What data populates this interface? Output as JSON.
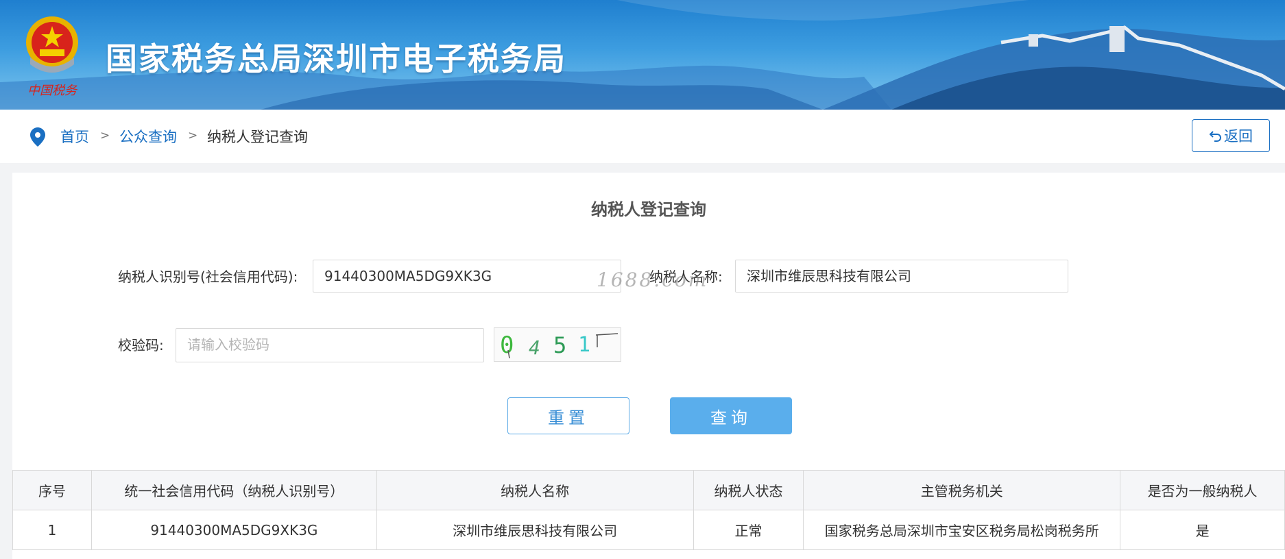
{
  "header": {
    "site_title": "国家税务总局深圳市电子税务局",
    "logo_caption": "中国税务",
    "brand_color": "#1f7fcf"
  },
  "breadcrumb": {
    "items": [
      {
        "label": "首页"
      },
      {
        "label": "公众查询"
      },
      {
        "label": "纳税人登记查询"
      }
    ],
    "separator": ">",
    "back_label": "返回"
  },
  "form": {
    "title": "纳税人登记查询",
    "taxpayer_id_label": "纳税人识别号(社会信用代码):",
    "taxpayer_id_value": "91440300MA5DG9XK3G",
    "taxpayer_name_label": "纳税人名称:",
    "taxpayer_name_value": "深圳市维辰思科技有限公司",
    "captcha_label": "校验码:",
    "captcha_placeholder": "请输入校验码",
    "captcha_image_text": "0451",
    "watermark": "1688.com",
    "reset_label": "重置",
    "query_label": "查询"
  },
  "results": {
    "columns": [
      "序号",
      "统一社会信用代码（纳税人识别号）",
      "纳税人名称",
      "纳税人状态",
      "主管税务机关",
      "是否为一般纳税人"
    ],
    "rows": [
      [
        "1",
        "91440300MA5DG9XK3G",
        "深圳市维辰思科技有限公司",
        "正常",
        "国家税务总局深圳市宝安区税务局松岗税务所",
        "是"
      ]
    ]
  }
}
